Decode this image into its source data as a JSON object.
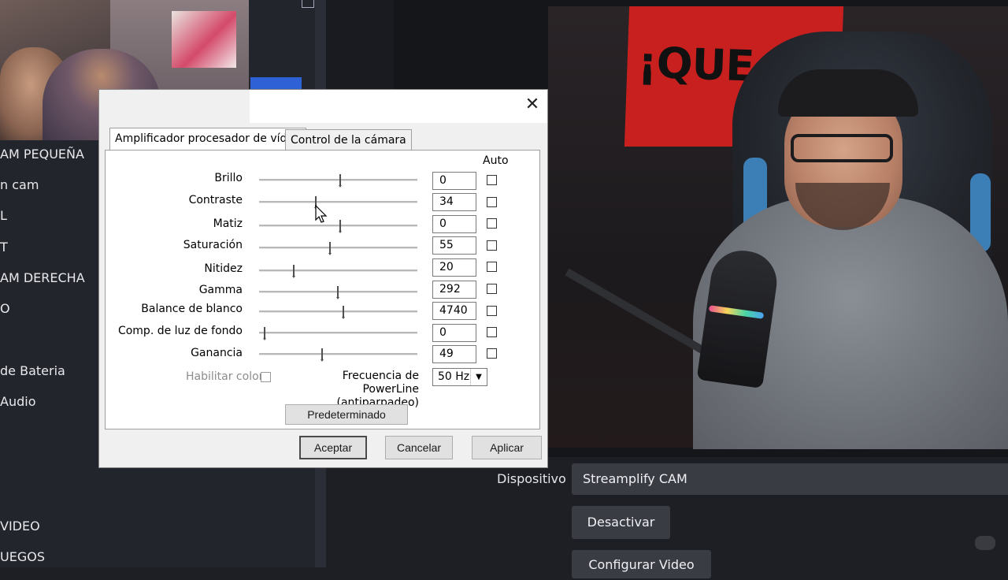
{
  "obs": {
    "scenes": [
      "AM PEQUEÑA",
      "n cam",
      "L",
      "T",
      "AM DERECHA",
      "O",
      "de Bateria",
      "Audio",
      "VIDEO",
      "UEGOS"
    ],
    "device_label": "Dispositivo",
    "device_value": "Streamplify CAM",
    "deactivate_button": "Desactivar",
    "configure_video_button": "Configurar Video"
  },
  "banner": {
    "text": "¡QUE NO FAL"
  },
  "dialog": {
    "tabs": [
      "Amplificador procesador de vídeo",
      "Control de la cámara"
    ],
    "auto_label": "Auto",
    "rows": [
      {
        "label": "Brillo",
        "value": "0",
        "level": 0.51
      },
      {
        "label": "Contraste",
        "value": "34",
        "level": 0.35
      },
      {
        "label": "Matiz",
        "value": "0",
        "level": 0.51
      },
      {
        "label": "Saturación",
        "value": "55",
        "level": 0.44
      },
      {
        "label": "Nitidez",
        "value": "20",
        "level": 0.21
      },
      {
        "label": "Gamma",
        "value": "292",
        "level": 0.49
      },
      {
        "label": "Balance de blanco",
        "value": "4740",
        "level": 0.53
      },
      {
        "label": "Comp. de luz de fondo",
        "value": "0",
        "level": 0.02
      },
      {
        "label": "Ganancia",
        "value": "49",
        "level": 0.39
      }
    ],
    "color_enable_label": "Habilitar color",
    "powerline_label_1": "Frecuencia de PowerLine",
    "powerline_label_2": "(antiparpadeo)",
    "powerline_value": "50 Hz",
    "default_button": "Predeterminado",
    "accept_button": "Aceptar",
    "cancel_button": "Cancelar",
    "apply_button": "Aplicar"
  }
}
